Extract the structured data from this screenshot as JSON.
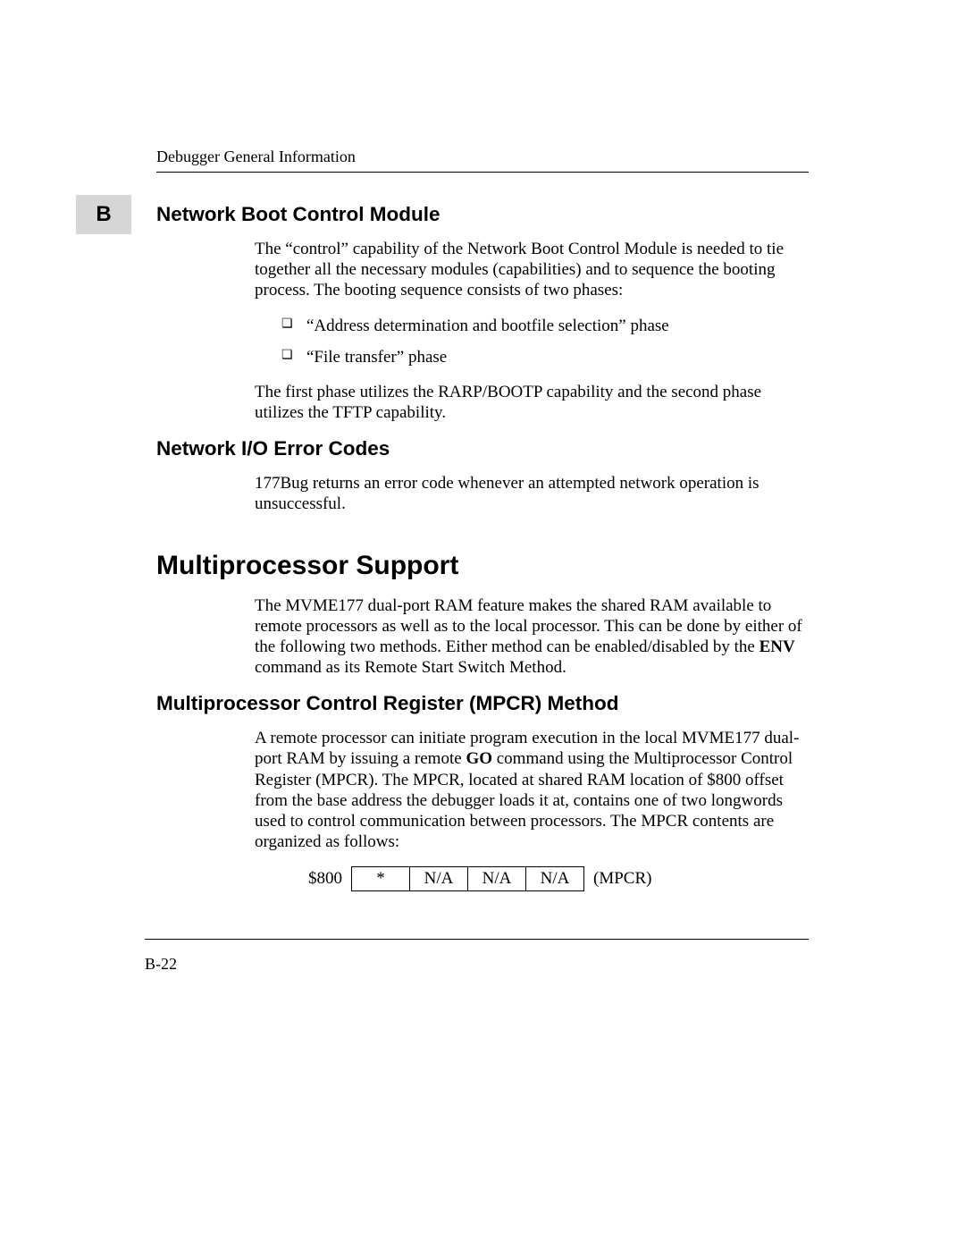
{
  "runningHead": "Debugger General Information",
  "appendixLetter": "B",
  "pageNumber": "B-22",
  "sections": {
    "netBoot": {
      "title": "Network Boot Control Module",
      "p1": "The “control” capability of the Network Boot Control Module is needed to tie together all the necessary modules (capabilities) and to sequence the booting process. The booting sequence consists of two phases:",
      "bullets": [
        "“Address determination and bootfile selection” phase",
        "“File transfer” phase"
      ],
      "p2": "The first phase utilizes the RARP/BOOTP capability and the second phase utilizes the TFTP capability."
    },
    "netErr": {
      "title": "Network I/O Error Codes",
      "p1": "177Bug returns an error code whenever an attempted network operation is unsuccessful."
    },
    "multi": {
      "title": "Multiprocessor Support",
      "p1_pre": "The MVME177 dual-port RAM feature makes the shared RAM available to remote processors as well as to the local processor. This can be done by either of the following two methods. Either method can be enabled/disabled by the ",
      "p1_bold": "ENV",
      "p1_post": " command as its Remote Start Switch Method."
    },
    "mpcr": {
      "title": "Multiprocessor Control Register (MPCR) Method",
      "p1_a": "A remote processor can initiate program execution in the local MVME177 dual-port RAM by issuing a remote ",
      "p1_bold": "GO",
      "p1_b": " command using the Multiprocessor Control Register (MPCR). The MPCR, located at shared RAM location of $800 offset from the base address the debugger loads it at, contains one of two longwords used to control communication between processors. The MPCR contents are organized as follows:",
      "reg": {
        "addr": "$800",
        "c0": "*",
        "c1": "N/A",
        "c2": "N/A",
        "c3": "N/A",
        "label": "(MPCR)"
      }
    }
  }
}
